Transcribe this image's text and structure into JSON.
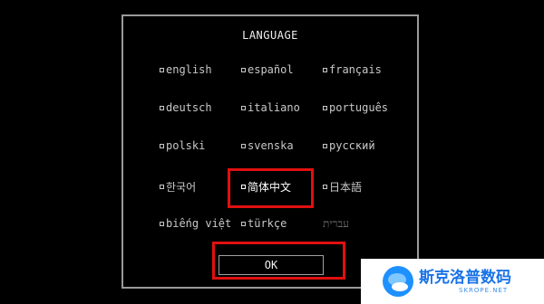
{
  "dialog": {
    "title": "LANGUAGE",
    "languages": [
      {
        "label": "english"
      },
      {
        "label": "español"
      },
      {
        "label": "français"
      },
      {
        "label": "deutsch"
      },
      {
        "label": "italiano"
      },
      {
        "label": "português"
      },
      {
        "label": "polski"
      },
      {
        "label": "svenska"
      },
      {
        "label": "русский"
      },
      {
        "label": "한국어"
      },
      {
        "label": "简体中文"
      },
      {
        "label": "日本語"
      },
      {
        "label": "biếng việt"
      },
      {
        "label": "türkçe"
      },
      {
        "label": "עברית"
      }
    ],
    "selected_language": "简体中文",
    "ok_label": "OK"
  },
  "colors": {
    "background": "#000000",
    "text": "#c8c8c8",
    "highlight": "#e01010"
  },
  "watermark": {
    "name": "斯克洛普数码",
    "url": "SKROPE.NET"
  }
}
